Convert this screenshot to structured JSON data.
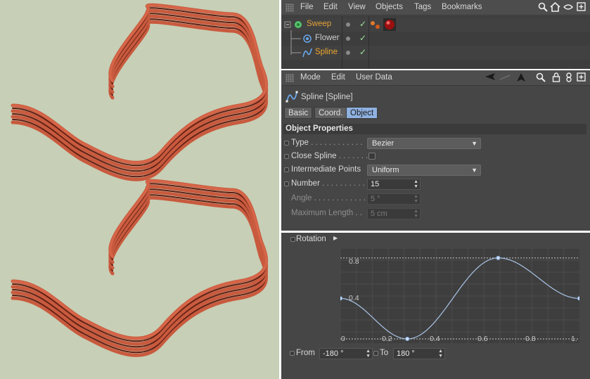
{
  "object_manager": {
    "menu": [
      "File",
      "Edit",
      "View",
      "Objects",
      "Tags",
      "Bookmarks"
    ],
    "toolbar_icons": [
      "search-icon",
      "home-icon",
      "eye-icon",
      "new-window-icon"
    ],
    "tree": [
      {
        "name": "Sweep",
        "color": "#e6a13a",
        "icon": "sweep-icon",
        "level": 0,
        "tags": [
          "material-tag-icon"
        ]
      },
      {
        "name": "Flower",
        "color": "#cfcfcf",
        "icon": "flower-icon",
        "level": 1,
        "tags": []
      },
      {
        "name": "Spline",
        "color": "#f0a830",
        "icon": "spline-icon",
        "level": 1,
        "tags": []
      }
    ]
  },
  "attribute_manager": {
    "menu": [
      "Mode",
      "Edit",
      "User Data"
    ],
    "object_title": "Spline [Spline]",
    "tabs": [
      {
        "label": "Basic",
        "active": false
      },
      {
        "label": "Coord.",
        "active": false
      },
      {
        "label": "Object",
        "active": true
      }
    ],
    "section_title": "Object Properties",
    "type": {
      "label": "Type",
      "dots": " . . . . . . . . . . . .",
      "value": "Bezier"
    },
    "close_spline": {
      "label": "Close Spline",
      "dots": " . . . . . . .",
      "checked": false
    },
    "intermediate_points": {
      "label": "Intermediate Points",
      "value": "Uniform"
    },
    "number": {
      "label": "Number",
      "dots": " . . . . . . . . . .",
      "value": "15"
    },
    "angle": {
      "label": "Angle",
      "dots": " . . . . . . . . . . . .",
      "value": "5 °"
    },
    "maximum_length": {
      "label": "Maximum Length",
      "dots": " . .",
      "value": "5 cm"
    }
  },
  "rotation_spline": {
    "label": "Rotation",
    "y_ticks": [
      "0.8",
      "0.4"
    ],
    "x_ticks": [
      "0",
      "0.2",
      "0.4",
      "0.6",
      "0.8",
      "1."
    ],
    "from_label": "From",
    "from_value": "-180 °",
    "to_label": "To",
    "to_value": "180 °",
    "curve_color": "#a9c3e6",
    "knots": [
      [
        0.0,
        0.5
      ],
      [
        0.28,
        0.0
      ],
      [
        0.66,
        1.0
      ],
      [
        1.0,
        0.5
      ]
    ]
  },
  "colors": {
    "viewport_bg": "#c7cfb6",
    "ribbon": "#d8674a",
    "active_tab": "#8fb1e0",
    "panel_bg": "#464646"
  }
}
